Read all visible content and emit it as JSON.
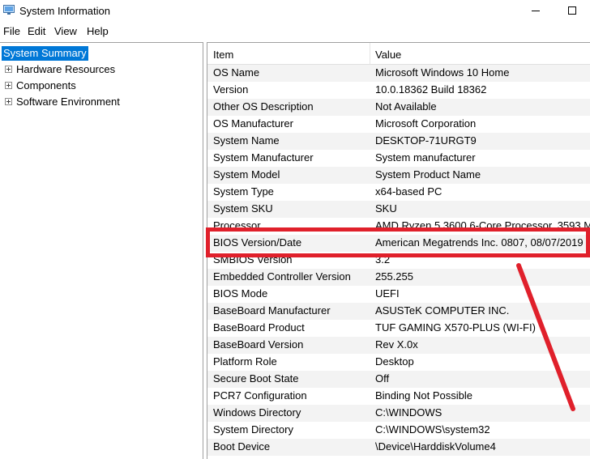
{
  "window": {
    "title": "System Information",
    "controls": {
      "minimize": "minimize",
      "maximize": "maximize"
    }
  },
  "menu": [
    "File",
    "Edit",
    "View",
    "Help"
  ],
  "tree": {
    "selected": "System Summary",
    "items": [
      "Hardware Resources",
      "Components",
      "Software Environment"
    ]
  },
  "table": {
    "columns": [
      "Item",
      "Value"
    ],
    "rows": [
      {
        "item": "OS Name",
        "value": "Microsoft Windows 10 Home"
      },
      {
        "item": "Version",
        "value": "10.0.18362 Build 18362"
      },
      {
        "item": "Other OS Description",
        "value": "Not Available"
      },
      {
        "item": "OS Manufacturer",
        "value": "Microsoft Corporation"
      },
      {
        "item": "System Name",
        "value": "DESKTOP-71URGT9"
      },
      {
        "item": "System Manufacturer",
        "value": "System manufacturer"
      },
      {
        "item": "System Model",
        "value": "System Product Name"
      },
      {
        "item": "System Type",
        "value": "x64-based PC"
      },
      {
        "item": "System SKU",
        "value": "SKU"
      },
      {
        "item": "Processor",
        "value": "AMD Ryzen 5 3600 6-Core Processor, 3593 M"
      },
      {
        "item": "BIOS Version/Date",
        "value": "American Megatrends Inc. 0807, 08/07/2019"
      },
      {
        "item": "SMBIOS Version",
        "value": "3.2"
      },
      {
        "item": "Embedded Controller Version",
        "value": "255.255"
      },
      {
        "item": "BIOS Mode",
        "value": "UEFI"
      },
      {
        "item": "BaseBoard Manufacturer",
        "value": "ASUSTeK COMPUTER INC."
      },
      {
        "item": "BaseBoard Product",
        "value": "TUF GAMING X570-PLUS (WI-FI)"
      },
      {
        "item": "BaseBoard Version",
        "value": "Rev X.0x"
      },
      {
        "item": "Platform Role",
        "value": "Desktop"
      },
      {
        "item": "Secure Boot State",
        "value": "Off"
      },
      {
        "item": "PCR7 Configuration",
        "value": "Binding Not Possible"
      },
      {
        "item": "Windows Directory",
        "value": "C:\\WINDOWS"
      },
      {
        "item": "System Directory",
        "value": "C:\\WINDOWS\\system32"
      },
      {
        "item": "Boot Device",
        "value": "\\Device\\HarddiskVolume4"
      }
    ]
  },
  "annotation": {
    "color": "#e0202b",
    "highlighted_row": "BIOS Version/Date"
  },
  "colors": {
    "selection": "#0078d7",
    "alt_row": "#f3f3f3"
  }
}
